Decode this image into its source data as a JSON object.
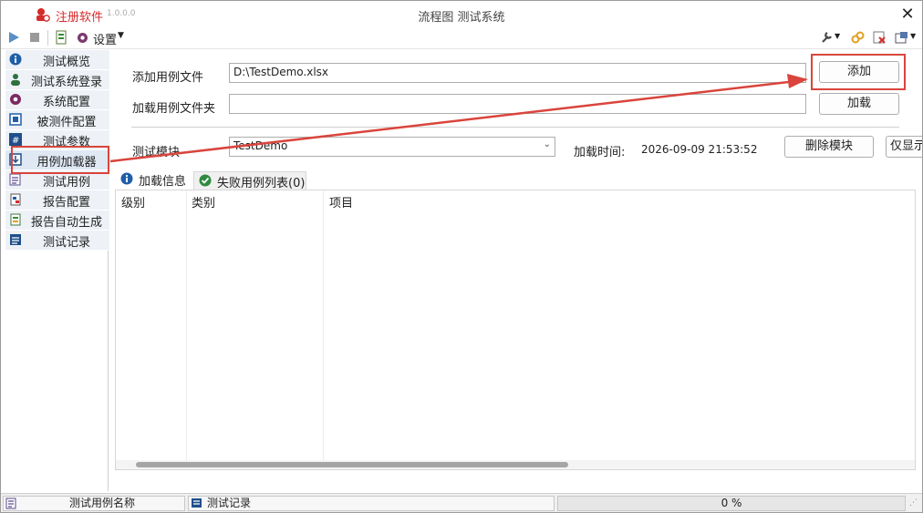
{
  "app": {
    "name": "注册软件",
    "version": "1.0.0.0",
    "title": "流程图 测试系统"
  },
  "toolbar": {
    "settings_label": "设置"
  },
  "sidebar": {
    "items": [
      {
        "label": "测试概览",
        "icon": "info-icon"
      },
      {
        "label": "测试系统登录",
        "icon": "user-icon"
      },
      {
        "label": "系统配置",
        "icon": "gear-icon"
      },
      {
        "label": "被测件配置",
        "icon": "device-icon"
      },
      {
        "label": "测试参数",
        "icon": "hash-icon"
      },
      {
        "label": "用例加载器",
        "icon": "download-icon"
      },
      {
        "label": "测试用例",
        "icon": "list-check-icon"
      },
      {
        "label": "报告配置",
        "icon": "report-icon"
      },
      {
        "label": "报告自动生成",
        "icon": "report-gen-icon"
      },
      {
        "label": "测试记录",
        "icon": "log-icon"
      }
    ]
  },
  "form": {
    "add_file_label": "添加用例文件",
    "add_file_value": "D:\\TestDemo.xlsx",
    "add_button": "添加",
    "load_folder_label": "加载用例文件夹",
    "load_folder_value": "",
    "load_button": "加载",
    "module_label": "测试模块",
    "module_value": "TestDemo",
    "load_time_label": "加载时间:",
    "load_time_value": "2026-09-09 21:53:52",
    "delete_module_button": "删除模块",
    "only_show_button": "仅显示"
  },
  "tabs": [
    {
      "label": "加载信息",
      "icon": "info-icon"
    },
    {
      "label": "失败用例列表(0)",
      "icon": "check-circle-icon"
    }
  ],
  "table": {
    "columns": [
      "级别",
      "类别",
      "项目"
    ],
    "rows": []
  },
  "statusbar": {
    "case_name": "测试用例名称",
    "log": "测试记录",
    "progress_text": "0 %",
    "progress_value": 0
  },
  "colors": {
    "highlight": "#d9453c",
    "accent": "#1f6fb5"
  }
}
